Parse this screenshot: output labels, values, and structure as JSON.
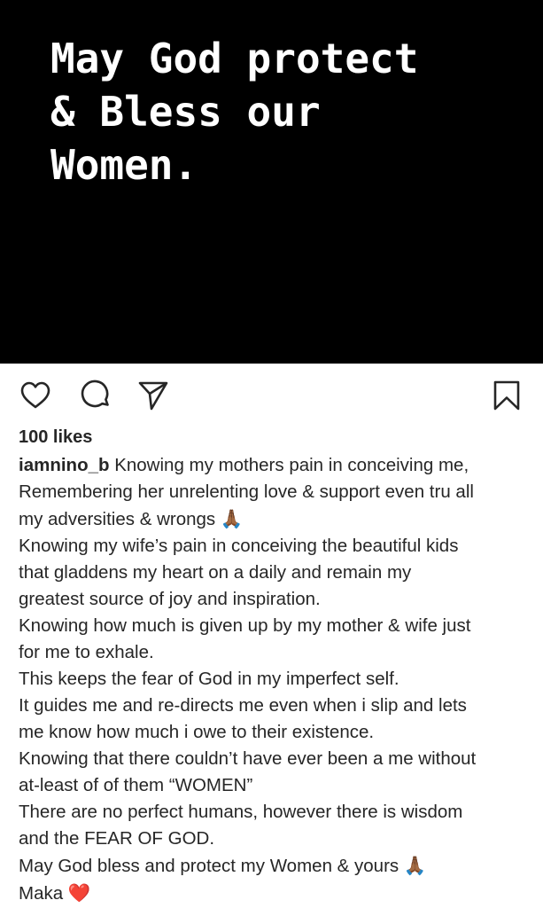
{
  "post": {
    "image_text": "May God protect\n& Bless our\nWomen."
  },
  "actions": {
    "like_icon": "heart-outline-icon",
    "comment_icon": "speech-bubble-icon",
    "share_icon": "paper-plane-icon",
    "save_icon": "bookmark-icon"
  },
  "likes": "100 likes",
  "caption": {
    "username": "iamnino_b",
    "lines": [
      " Knowing my mothers pain in conceiving me,",
      "Remembering her unrelenting love & support even tru all",
      "my adversities & wrongs ",
      "Knowing my wife’s pain in conceiving the beautiful kids",
      "that gladdens my heart on a daily and remain my",
      "greatest source of joy and inspiration.",
      "Knowing how much is given up by my mother & wife just",
      "for me to exhale.",
      "This keeps the fear of God in my imperfect self.",
      "It guides me and re-directs me even when i slip and lets",
      "me know how much i owe to their existence.",
      "Knowing that there couldn’t have ever been a me without",
      "at-least of of them “WOMEN”",
      "There are no perfect humans, however there is wisdom",
      "and the FEAR OF GOD.",
      "May God bless and protect my Women & yours ",
      "Maka "
    ],
    "emoji_pray": "🙏🏾",
    "emoji_heart": "❤️"
  }
}
